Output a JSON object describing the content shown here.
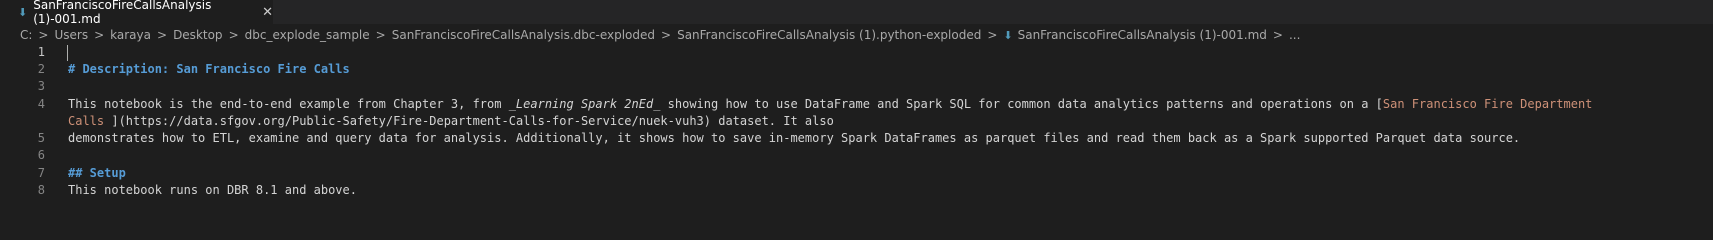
{
  "tab": {
    "title": "SanFranciscoFireCallsAnalysis (1)-001.md",
    "icon": "markdown-file-icon",
    "close_glyph": "✕"
  },
  "breadcrumb": {
    "items": [
      "C:",
      "Users",
      "karaya",
      "Desktop",
      "dbc_explode_sample",
      "SanFranciscoFireCallsAnalysis.dbc-exploded",
      "SanFranciscoFireCallsAnalysis (1).python-exploded",
      "SanFranciscoFireCallsAnalysis (1)-001.md",
      "..."
    ],
    "separator": ">"
  },
  "editor": {
    "line_numbers": [
      "1",
      "2",
      "3",
      "4",
      "5",
      "6",
      "7",
      "8"
    ],
    "line2": "# Description: San Francisco Fire Calls",
    "line4_a": "This notebook is the end-to-end example from Chapter 3, from ",
    "line4_italic": "_Learning Spark 2nEd_",
    "line4_b": " showing how to use DataFrame and Spark SQL for common data analytics patterns and operations on a [",
    "line4_linktext": "San Francisco Fire Department",
    "line4w_linktext": "Calls ",
    "line4w_rest": "](https://data.sfgov.org/Public-Safety/Fire-Department-Calls-for-Service/nuek-vuh3) dataset. It also",
    "line5": "demonstrates how to ETL, examine and query data for analysis. Additionally, it shows how to save in-memory Spark DataFrames as parquet files and read them back as a Spark supported Parquet data source.",
    "line7": "## Setup",
    "line8": "This notebook runs on DBR 8.1 and above."
  },
  "colors": {
    "background": "#1e1e1e",
    "heading": "#569cd6",
    "link_text": "#ce9178",
    "text": "#d4d4d4"
  }
}
